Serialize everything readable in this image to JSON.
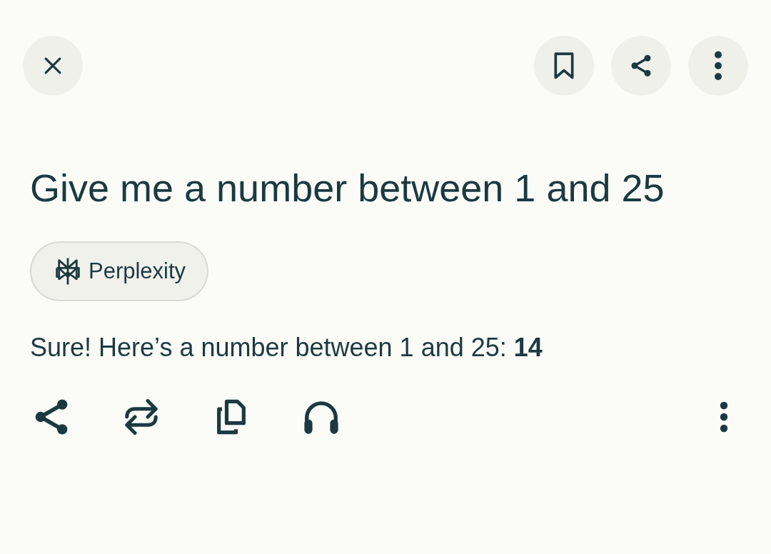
{
  "question": "Give me a number between 1 and 25",
  "source_chip": {
    "label": "Perplexity"
  },
  "answer": "Sure! Here’s a number between 1 and 25: **14**"
}
